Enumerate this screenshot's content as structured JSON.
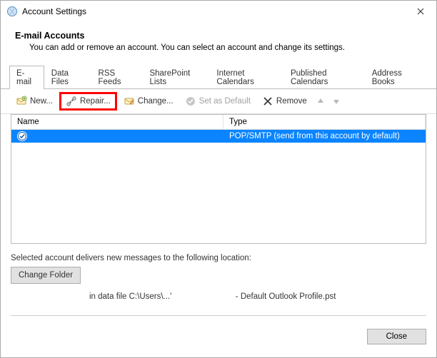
{
  "window": {
    "title": "Account Settings",
    "close_label": "✕"
  },
  "header": {
    "title": "E-mail Accounts",
    "description": "You can add or remove an account. You can select an account and change its settings."
  },
  "tabs": [
    {
      "label": "E-mail"
    },
    {
      "label": "Data Files"
    },
    {
      "label": "RSS Feeds"
    },
    {
      "label": "SharePoint Lists"
    },
    {
      "label": "Internet Calendars"
    },
    {
      "label": "Published Calendars"
    },
    {
      "label": "Address Books"
    }
  ],
  "toolbar": {
    "new_label": "New...",
    "repair_label": "Repair...",
    "change_label": "Change...",
    "set_default_label": "Set as Default",
    "remove_label": "Remove"
  },
  "list": {
    "columns": {
      "name": "Name",
      "type": "Type"
    },
    "rows": [
      {
        "name": "",
        "type": "POP/SMTP (send from this account by default)"
      }
    ]
  },
  "footer": {
    "desc": "Selected account delivers new messages to the following location:",
    "change_folder_label": "Change Folder",
    "location_prefix": "in data file C:\\Users\\...'",
    "location_suffix": "- Default Outlook Profile.pst"
  },
  "dialog": {
    "close_label": "Close"
  }
}
